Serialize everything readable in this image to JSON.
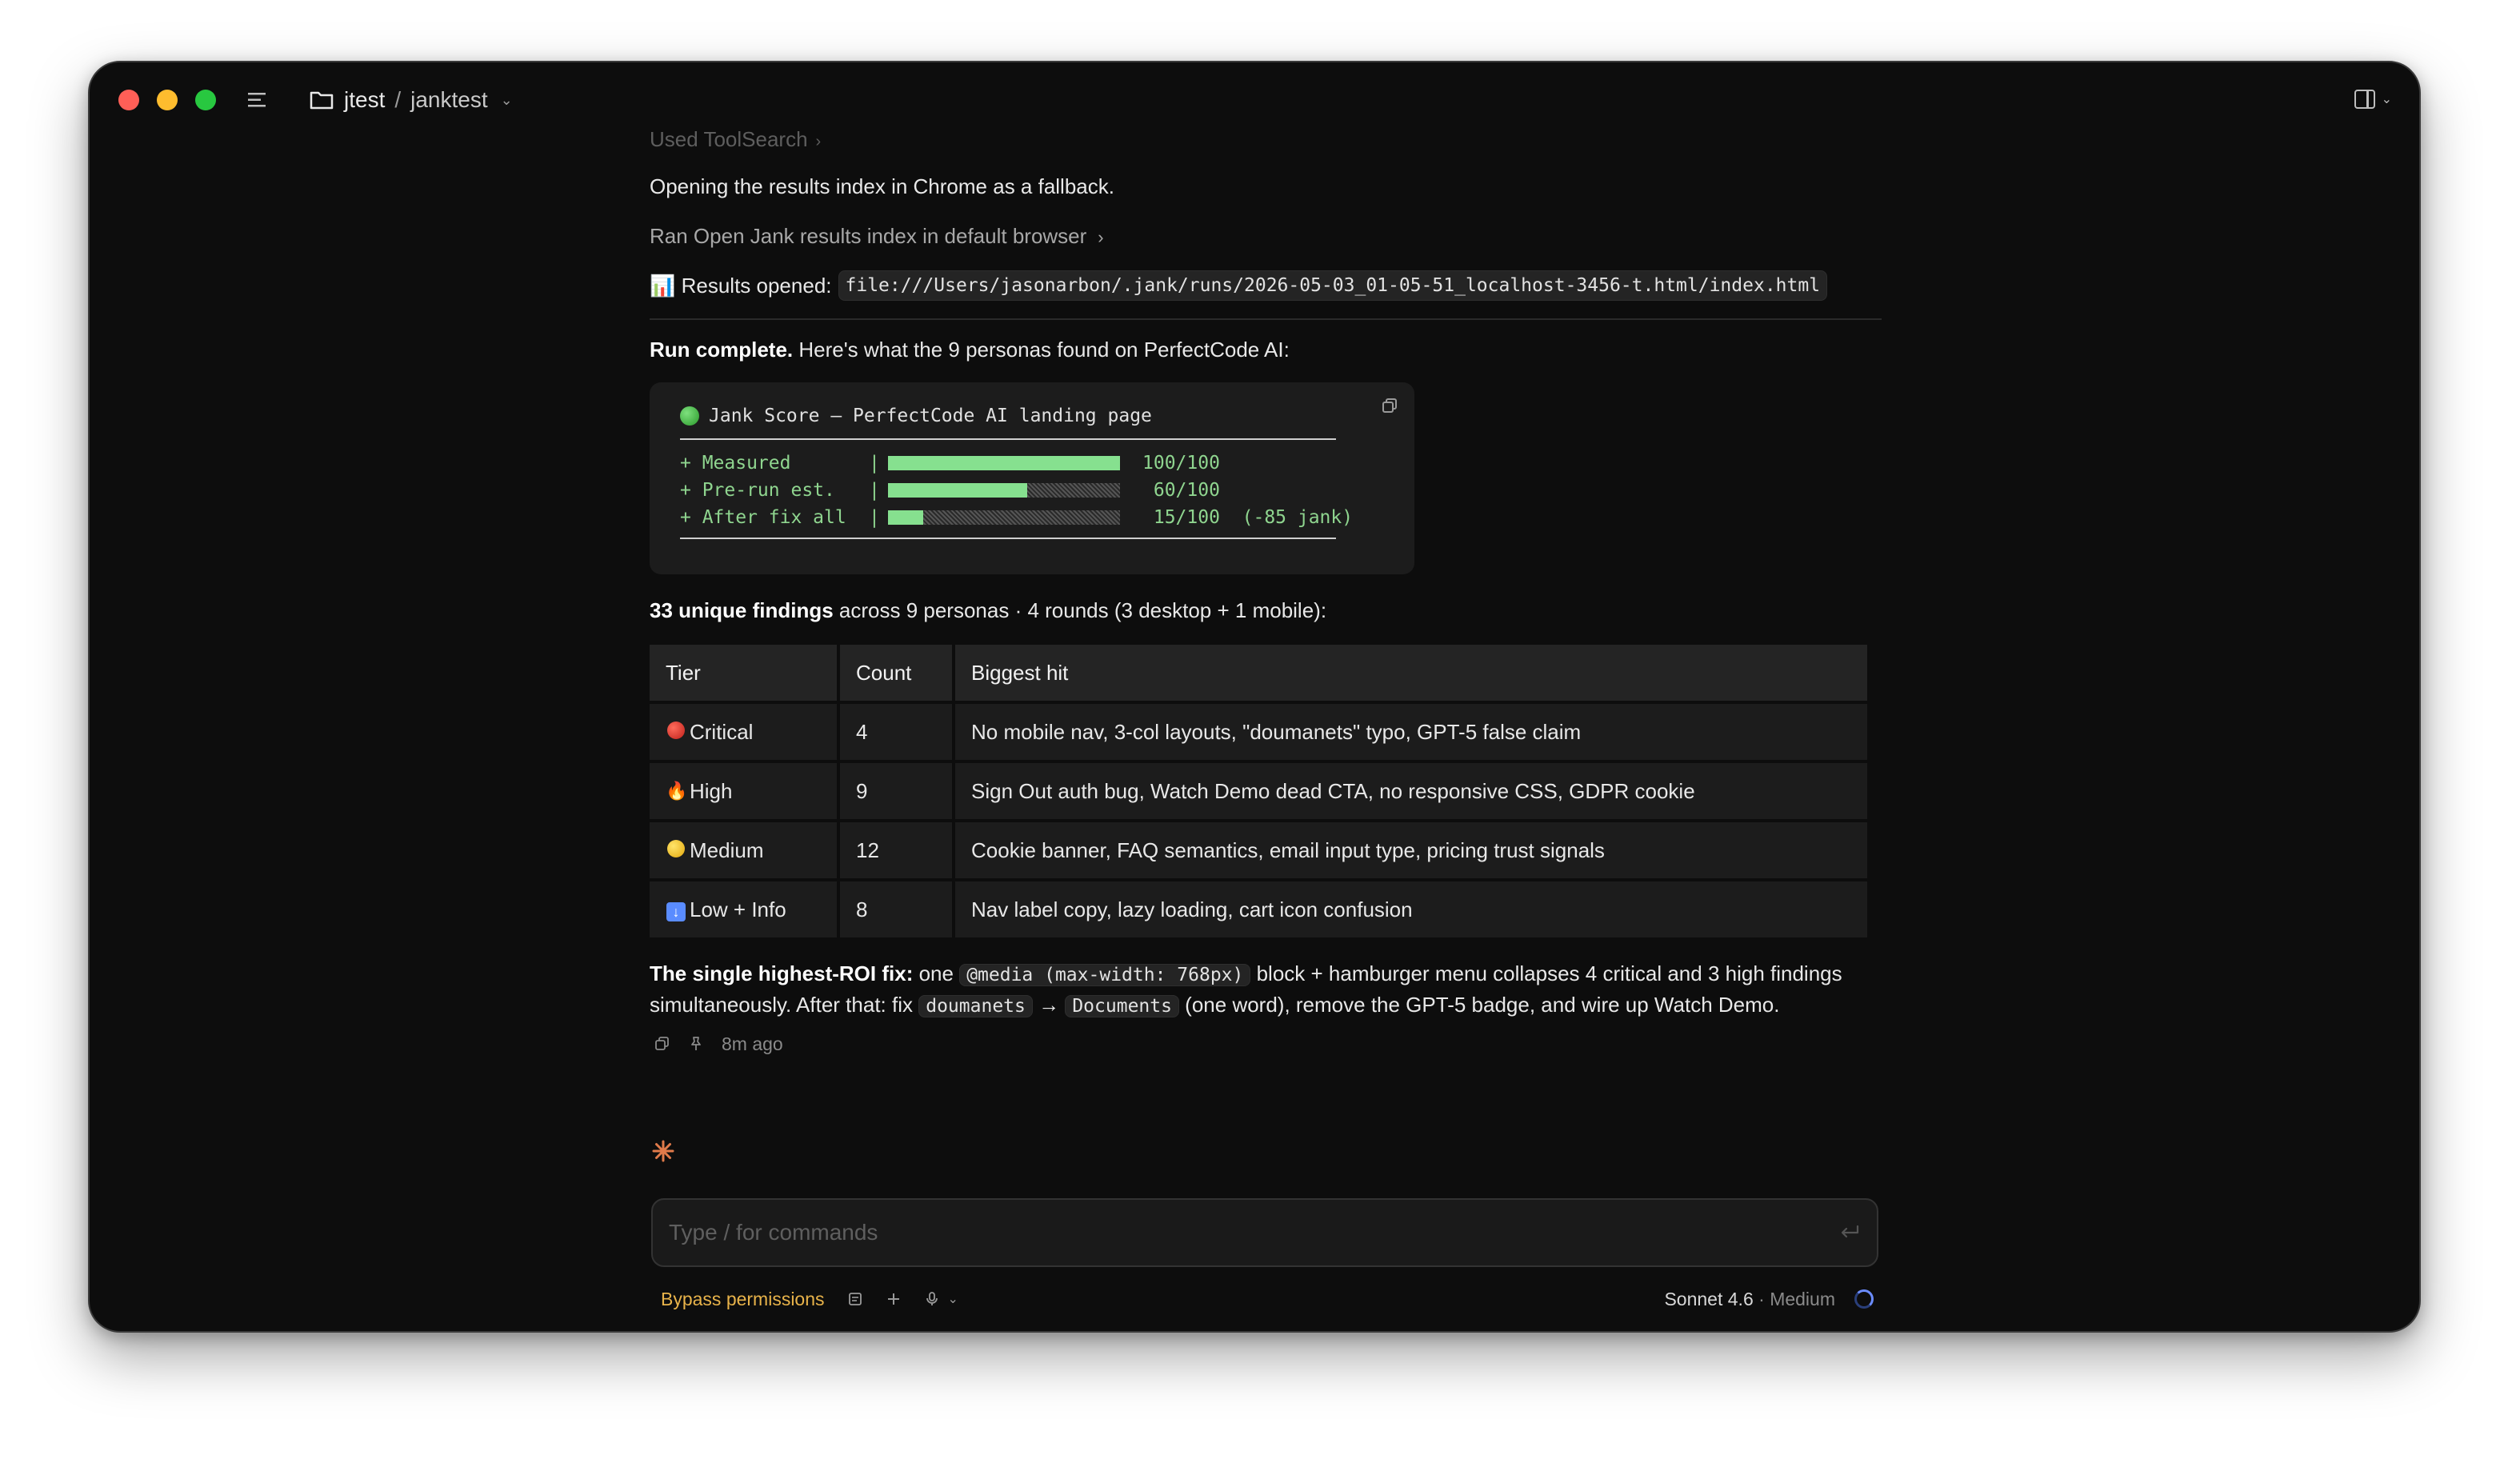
{
  "window": {
    "path_root": "jtest",
    "path_separator": "/",
    "path_sub": "janktest"
  },
  "chat": {
    "faded_line": "Used ToolSearch",
    "opening_line": "Opening the results index in Chrome as a fallback.",
    "tool_line": "Ran Open Jank results index in default browser",
    "results_label": "📊 Results opened:",
    "results_path": "file:///Users/jasonarbon/.jank/runs/2026-05-03_01-05-51_localhost-3456-t.html/index.html",
    "run_complete_bold": "Run complete.",
    "run_complete_rest": " Here's what the 9 personas found on PerfectCode AI:",
    "code_block": {
      "title": "Jank Score — PerfectCode AI landing page",
      "rows": [
        {
          "label": "+ Measured",
          "pipe": "|",
          "value_text": "100/100",
          "fill": 1.0
        },
        {
          "label": "+ Pre-run est.",
          "pipe": "|",
          "value_text": " 60/100",
          "fill": 0.6
        },
        {
          "label": "+ After fix all",
          "pipe": "|",
          "value_text": " 15/100  (-85 jank)",
          "fill": 0.15
        }
      ]
    },
    "findings_bold": "33 unique findings",
    "findings_rest": " across 9 personas · 4 rounds (3 desktop + 1 mobile):",
    "table": {
      "headers": [
        "Tier",
        "Count",
        "Biggest hit"
      ],
      "rows": [
        {
          "tier": "Critical",
          "icon": "red-circle-icon",
          "count": "4",
          "hit": "No mobile nav, 3-col layouts, \"doumanets\" typo, GPT-5 false claim"
        },
        {
          "tier": "High",
          "icon": "fire-icon",
          "count": "9",
          "hit": "Sign Out auth bug, Watch Demo dead CTA, no responsive CSS, GDPR cookie"
        },
        {
          "tier": "Medium",
          "icon": "yellow-circle-icon",
          "count": "12",
          "hit": "Cookie banner, FAQ semantics, email input type, pricing trust signals"
        },
        {
          "tier": "Low + Info",
          "icon": "down-arrow-icon",
          "count": "8",
          "hit": "Nav label copy, lazy loading, cart icon confusion"
        }
      ]
    },
    "roi": {
      "bold": "The single highest-ROI fix:",
      "t1": " one ",
      "code1": "@media (max-width: 768px)",
      "t2": " block + hamburger menu collapses 4 critical and 3 high findings simultaneously. After that: fix ",
      "code2": "doumanets",
      "arrow": "→",
      "code3": "Documents",
      "t3": " (one word), remove the GPT-5 badge, and wire up Watch Demo."
    },
    "timestamp": "8m ago"
  },
  "composer": {
    "placeholder": "Type / for commands",
    "value": ""
  },
  "footer": {
    "bypass": "Bypass permissions",
    "model": "Sonnet 4.6",
    "model_sep": " · ",
    "effort": "Medium"
  },
  "colors": {
    "background": "#0d0d0d",
    "bar_green": "#86e08f",
    "bypass": "#e8b34a",
    "accent_blue": "#6b8cff"
  }
}
